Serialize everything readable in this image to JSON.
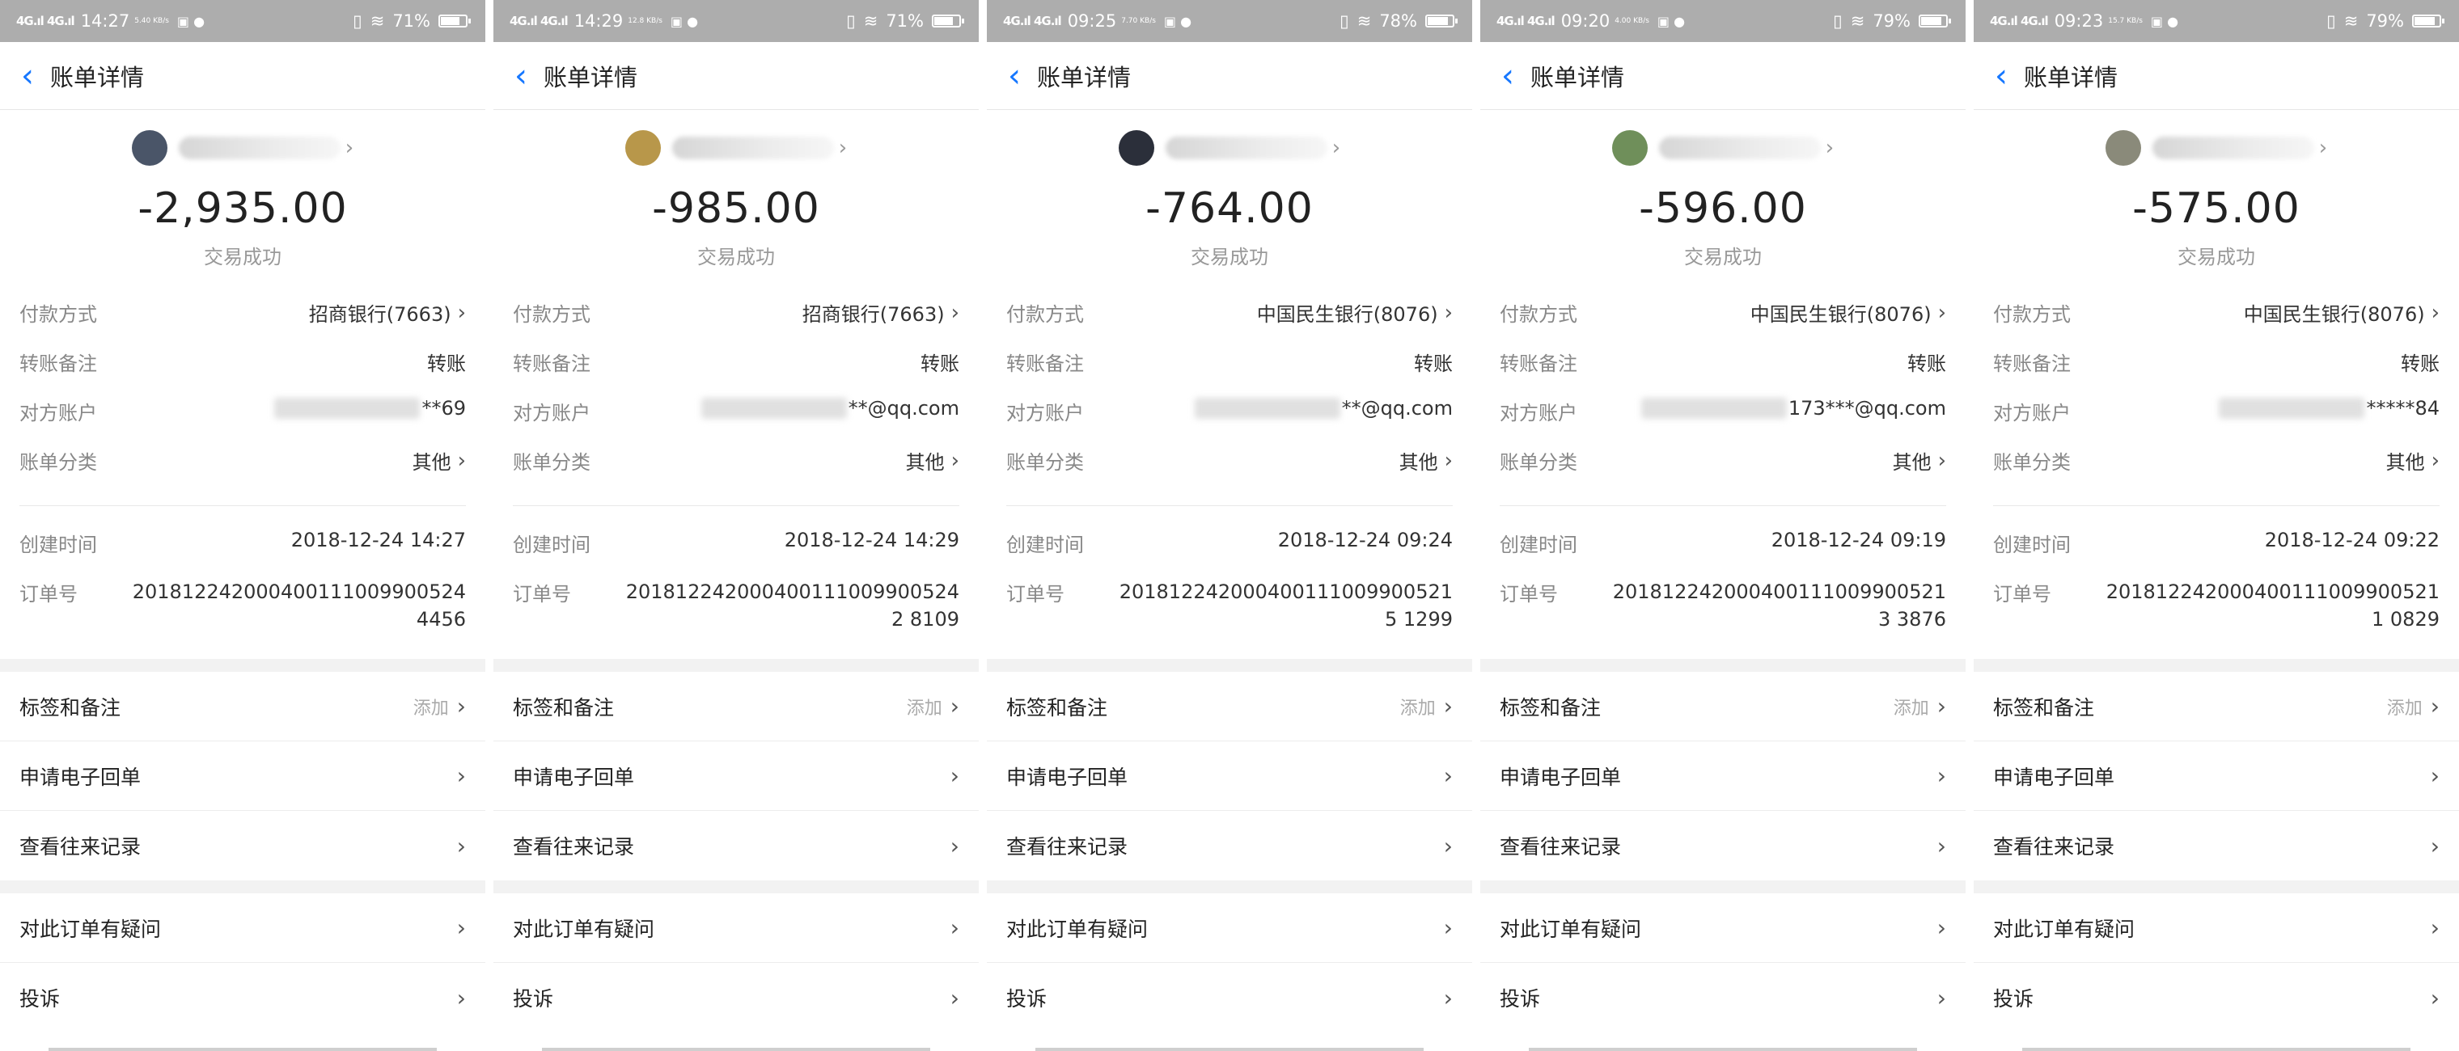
{
  "panels": [
    {
      "status": {
        "time": "14:27",
        "speed": "5.40 KB/s",
        "battery": "71%",
        "battery_level": 0.71
      },
      "header": {
        "title": "账单详情"
      },
      "avatar_color": "#4a5568",
      "amount": "-2,935.00",
      "state": "交易成功",
      "payment": {
        "label": "付款方式",
        "value": "招商银行(7663)"
      },
      "note": {
        "label": "转账备注",
        "value": "转账"
      },
      "account": {
        "label": "对方账户",
        "value": "**69"
      },
      "category": {
        "label": "账单分类",
        "value": "其他"
      },
      "created": {
        "label": "创建时间",
        "value": "2018-12-24 14:27"
      },
      "order": {
        "label": "订单号",
        "value": "2018122420004001110099005244456"
      },
      "tags": {
        "label": "标签和备注",
        "action": "添加"
      },
      "receipt": "申请电子回单",
      "history": "查看往来记录",
      "question": "对此订单有疑问",
      "complaint": "投诉"
    },
    {
      "status": {
        "time": "14:29",
        "speed": "12.8 KB/s",
        "battery": "71%",
        "battery_level": 0.71
      },
      "header": {
        "title": "账单详情"
      },
      "avatar_color": "#b8974a",
      "amount": "-985.00",
      "state": "交易成功",
      "payment": {
        "label": "付款方式",
        "value": "招商银行(7663)"
      },
      "note": {
        "label": "转账备注",
        "value": "转账"
      },
      "account": {
        "label": "对方账户",
        "value": "**@qq.com"
      },
      "category": {
        "label": "账单分类",
        "value": "其他"
      },
      "created": {
        "label": "创建时间",
        "value": "2018-12-24 14:29"
      },
      "order": {
        "label": "订单号",
        "value": "2018122420004001110099005242 8109"
      },
      "tags": {
        "label": "标签和备注",
        "action": "添加"
      },
      "receipt": "申请电子回单",
      "history": "查看往来记录",
      "question": "对此订单有疑问",
      "complaint": "投诉"
    },
    {
      "status": {
        "time": "09:25",
        "speed": "7.70 KB/s",
        "battery": "78%",
        "battery_level": 0.78
      },
      "header": {
        "title": "账单详情"
      },
      "avatar_color": "#2b2f3a",
      "amount": "-764.00",
      "state": "交易成功",
      "payment": {
        "label": "付款方式",
        "value": "中国民生银行(8076)"
      },
      "note": {
        "label": "转账备注",
        "value": "转账"
      },
      "account": {
        "label": "对方账户",
        "value": "**@qq.com"
      },
      "category": {
        "label": "账单分类",
        "value": "其他"
      },
      "created": {
        "label": "创建时间",
        "value": "2018-12-24 09:24"
      },
      "order": {
        "label": "订单号",
        "value": "2018122420004001110099005215 1299"
      },
      "tags": {
        "label": "标签和备注",
        "action": "添加"
      },
      "receipt": "申请电子回单",
      "history": "查看往来记录",
      "question": "对此订单有疑问",
      "complaint": "投诉"
    },
    {
      "status": {
        "time": "09:20",
        "speed": "4.00 KB/s",
        "battery": "79%",
        "battery_level": 0.79
      },
      "header": {
        "title": "账单详情"
      },
      "avatar_color": "#6f8f5a",
      "amount": "-596.00",
      "state": "交易成功",
      "payment": {
        "label": "付款方式",
        "value": "中国民生银行(8076)"
      },
      "note": {
        "label": "转账备注",
        "value": "转账"
      },
      "account": {
        "label": "对方账户",
        "value": "173***@qq.com"
      },
      "category": {
        "label": "账单分类",
        "value": "其他"
      },
      "created": {
        "label": "创建时间",
        "value": "2018-12-24 09:19"
      },
      "order": {
        "label": "订单号",
        "value": "2018122420004001110099005213 3876"
      },
      "tags": {
        "label": "标签和备注",
        "action": "添加"
      },
      "receipt": "申请电子回单",
      "history": "查看往来记录",
      "question": "对此订单有疑问",
      "complaint": "投诉"
    },
    {
      "status": {
        "time": "09:23",
        "speed": "15.7 KB/s",
        "battery": "79%",
        "battery_level": 0.79
      },
      "header": {
        "title": "账单详情"
      },
      "avatar_color": "#8a8a7a",
      "amount": "-575.00",
      "state": "交易成功",
      "payment": {
        "label": "付款方式",
        "value": "中国民生银行(8076)"
      },
      "note": {
        "label": "转账备注",
        "value": "转账"
      },
      "account": {
        "label": "对方账户",
        "value": "*****84"
      },
      "category": {
        "label": "账单分类",
        "value": "其他"
      },
      "created": {
        "label": "创建时间",
        "value": "2018-12-24 09:22"
      },
      "order": {
        "label": "订单号",
        "value": "2018122420004001110099005211 0829"
      },
      "tags": {
        "label": "标签和备注",
        "action": "添加"
      },
      "receipt": "申请电子回单",
      "history": "查看往来记录",
      "question": "对此订单有疑问",
      "complaint": "投诉"
    }
  ],
  "icons": {
    "back": "chevron-left-icon",
    "arrow": "chevron-right-icon",
    "wifi": "wifi-icon",
    "signal": "signal-icon",
    "battery": "battery-icon",
    "vibrate": "vibrate-icon"
  },
  "colors": {
    "accent": "#1677ff",
    "status_bar": "#adadad",
    "label": "#888888",
    "separator": "#f2f2f2"
  }
}
